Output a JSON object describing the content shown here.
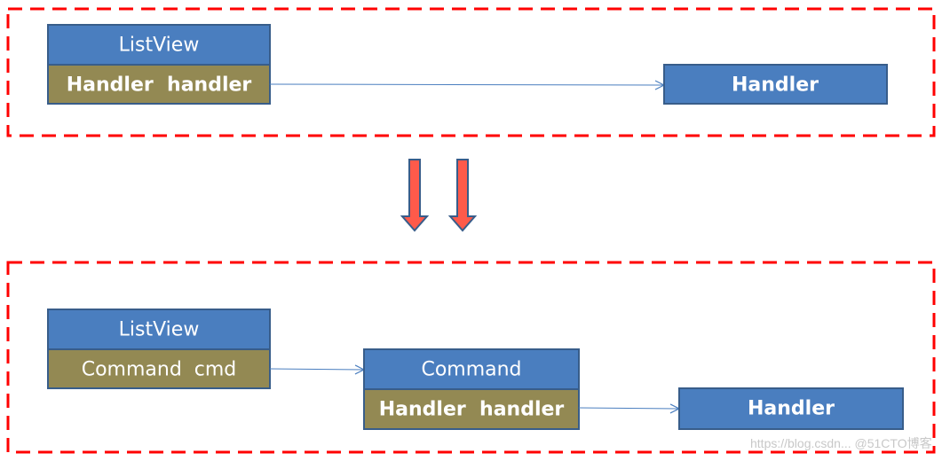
{
  "colors": {
    "blue": "#4a7ebf",
    "olive": "#938953",
    "border": "#385d8a",
    "dash": "#ff0000",
    "down_arrow": "#ff5a4a",
    "connector": "#4a7ebf"
  },
  "before": {
    "listview": {
      "title": "ListView",
      "field": "Handler  handler"
    },
    "handler": {
      "label": "Handler"
    }
  },
  "after": {
    "listview": {
      "title": "ListView",
      "field": "Command  cmd"
    },
    "command": {
      "title": "Command",
      "field": "Handler  handler"
    },
    "handler": {
      "label": "Handler"
    }
  },
  "watermark": "https://blog.csdn... @51CTO博客"
}
